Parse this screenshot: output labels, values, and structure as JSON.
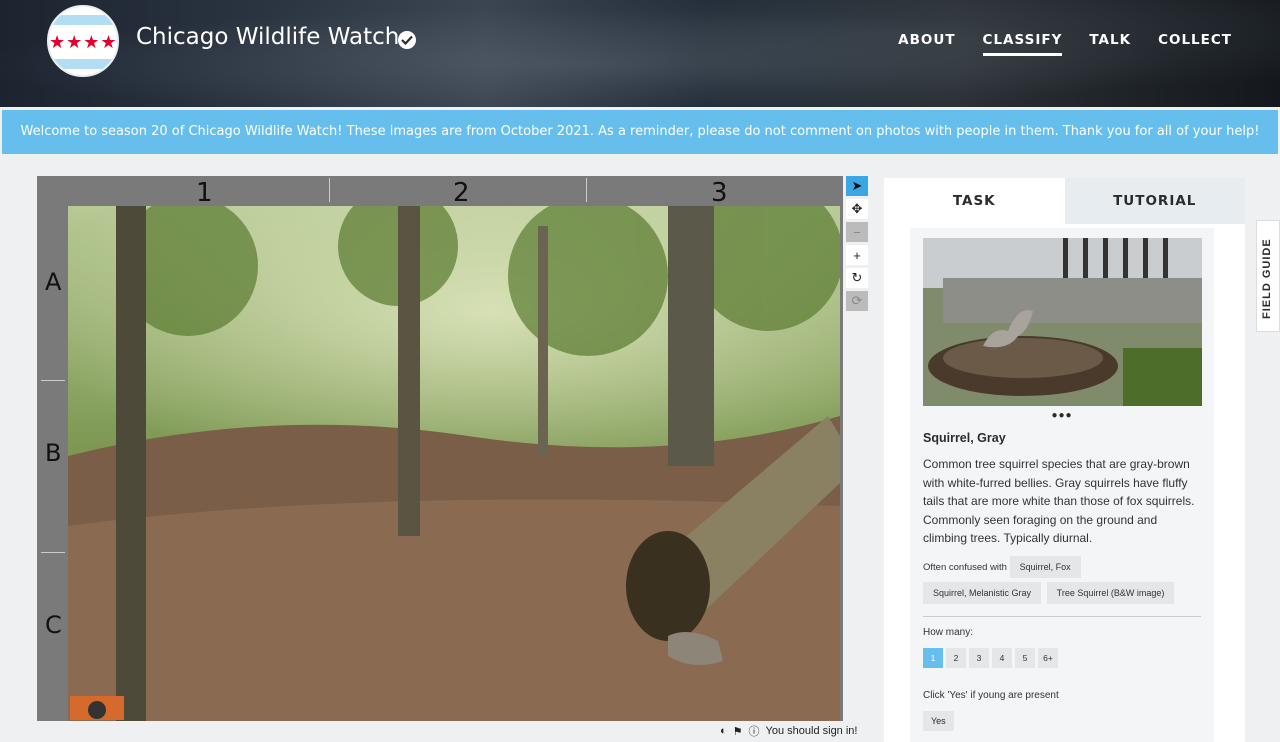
{
  "header": {
    "project_title": "Chicago Wildlife Watch",
    "nav": [
      {
        "label": "ABOUT",
        "active": false
      },
      {
        "label": "CLASSIFY",
        "active": true
      },
      {
        "label": "TALK",
        "active": false
      },
      {
        "label": "COLLECT",
        "active": false
      }
    ],
    "logo_stars": "★★★★"
  },
  "banner": {
    "text": "Welcome to season 20 of Chicago Wildlife Watch! These images are from October 2021. As a reminder, please do not comment on photos with people in them. Thank you for all of your help!",
    "color": "#65beeb"
  },
  "viewer": {
    "columns": [
      "1",
      "2",
      "3"
    ],
    "rows": [
      "A",
      "B",
      "C"
    ],
    "tools": [
      "pointer-icon",
      "move-icon",
      "zoom-out-icon",
      "zoom-in-icon",
      "rotate-icon",
      "reset-icon"
    ],
    "footer_text": "You should sign in!"
  },
  "panel": {
    "tabs": [
      "TASK",
      "TUTORIAL"
    ],
    "species_name": "Squirrel, Gray",
    "description": "Common tree squirrel species that are gray-brown with white-furred bellies. Gray squirrels have fluffy tails that are more white than those of fox squirrels. Commonly seen foraging on the ground and climbing trees. Typically diurnal.",
    "confused_label": "Often confused with",
    "confused_with": [
      "Squirrel, Fox",
      "Squirrel, Melanistic Gray",
      "Tree Squirrel (B&W image)"
    ],
    "how_many_label": "How many:",
    "how_many_options": [
      "1",
      "2",
      "3",
      "4",
      "5",
      "6+"
    ],
    "how_many_selected": "1",
    "young_label": "Click 'Yes' if young are present",
    "young_button": "Yes",
    "carousel_dots": "●●●"
  },
  "field_guide": {
    "label": "FIELD GUIDE"
  }
}
